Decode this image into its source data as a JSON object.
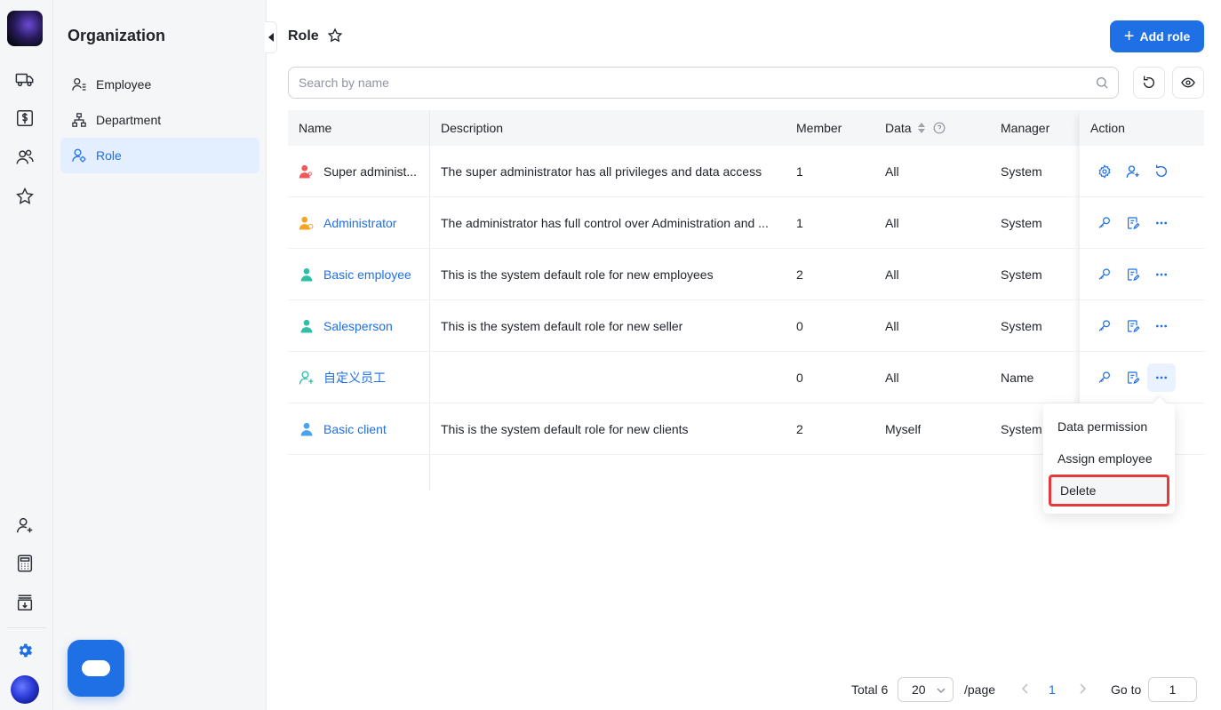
{
  "rail": {
    "icons": [
      "truck-icon",
      "dollar-icon",
      "users-icon",
      "star-icon",
      "user-plus-icon",
      "calculator-icon",
      "download-box-icon",
      "gear-icon"
    ]
  },
  "sidebar": {
    "title": "Organization",
    "items": [
      {
        "label": "Employee",
        "icon": "employee-icon"
      },
      {
        "label": "Department",
        "icon": "department-icon"
      },
      {
        "label": "Role",
        "icon": "role-icon",
        "active": true
      }
    ]
  },
  "header": {
    "title": "Role",
    "add_label": "Add role"
  },
  "search": {
    "placeholder": "Search by name"
  },
  "table": {
    "columns": [
      "Name",
      "Description",
      "Member",
      "Data",
      "Manager",
      "Action"
    ],
    "rows": [
      {
        "name": "Super administ...",
        "description": "The super administrator has all privileges and data access",
        "member": "1",
        "data": "All",
        "manager": "System"
      },
      {
        "name": "Administrator",
        "description": "The administrator has full control over Administration and ...",
        "member": "1",
        "data": "All",
        "manager": "System"
      },
      {
        "name": "Basic employee",
        "description": "This is the system default role for new employees",
        "member": "2",
        "data": "All",
        "manager": "System"
      },
      {
        "name": "Salesperson",
        "description": "This is the system default role for new seller",
        "member": "0",
        "data": "All",
        "manager": "System"
      },
      {
        "name": "自定义员工",
        "description": "",
        "member": "0",
        "data": "All",
        "manager": "Name"
      },
      {
        "name": "Basic client",
        "description": "This is the system default role for new clients",
        "member": "2",
        "data": "Myself",
        "manager": "System"
      }
    ]
  },
  "menu": {
    "items": [
      "Data permission",
      "Assign employee",
      "Delete"
    ]
  },
  "pager": {
    "total": "Total 6",
    "page_size": "20",
    "per_page": "/page",
    "current": "1",
    "goto_label": "Go to",
    "goto_value": "1"
  },
  "colors": {
    "accent": "#1f6fe5",
    "danger_outline": "#e5393a"
  }
}
